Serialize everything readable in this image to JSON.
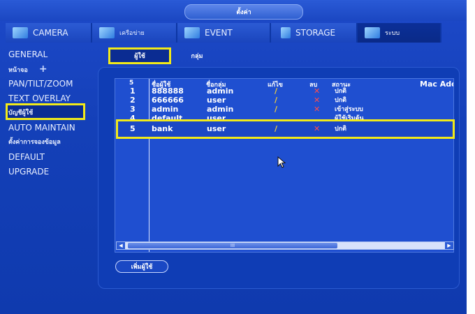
{
  "window": {
    "title": "ตั้งค่า"
  },
  "tabs": [
    {
      "label": "CAMERA",
      "icon": "camera-icon"
    },
    {
      "label": "เครือข่าย",
      "icon": "network-icon"
    },
    {
      "label": "EVENT",
      "icon": "event-icon"
    },
    {
      "label": "STORAGE",
      "icon": "storage-icon"
    },
    {
      "label": "ระบบ",
      "icon": "system-icon",
      "active": true
    }
  ],
  "sidebar": {
    "items": [
      {
        "label": "GENERAL"
      },
      {
        "label": "หน้าจอ",
        "suffix": "+"
      },
      {
        "label": "PAN/TILT/ZOOM"
      },
      {
        "label": "TEXT OVERLAY"
      },
      {
        "label": "บัญชีผู้ใช้",
        "selected": true
      },
      {
        "label": "AUTO MAINTAIN"
      },
      {
        "label": "ตั้งค่าการจองข้อมูล"
      },
      {
        "label": "DEFAULT"
      },
      {
        "label": "UPGRADE"
      }
    ]
  },
  "subtabs": {
    "users": "ผู้ใช้",
    "groups": "กลุ่ม"
  },
  "table": {
    "count": "5",
    "headers": {
      "username": "ชื่อผู้ใช้",
      "group": "ชื่อกลุ่ม",
      "edit": "แก้ไข",
      "delete": "ลบ",
      "status": "สถานะ",
      "mac": "Mac Add"
    },
    "rows": [
      {
        "no": "1",
        "username": "888888",
        "group": "admin",
        "status": "ปกติ"
      },
      {
        "no": "2",
        "username": "666666",
        "group": "user",
        "status": "ปกติ"
      },
      {
        "no": "3",
        "username": "admin",
        "group": "admin",
        "status": "เข้าสู่ระบบ"
      },
      {
        "no": "4",
        "username": "default",
        "group": "user",
        "status": "ผู้ใช้เริ่มต้น"
      },
      {
        "no": "5",
        "username": "bank",
        "group": "user",
        "status": "ปกติ"
      }
    ],
    "scroll_thumb": "III"
  },
  "add_user_button": "เพิ่มผู้ใช้",
  "colors": {
    "highlight": "#f2ea18",
    "background": "#1440b8",
    "edit": "#f4cf3a",
    "delete": "#ff4d4d"
  }
}
